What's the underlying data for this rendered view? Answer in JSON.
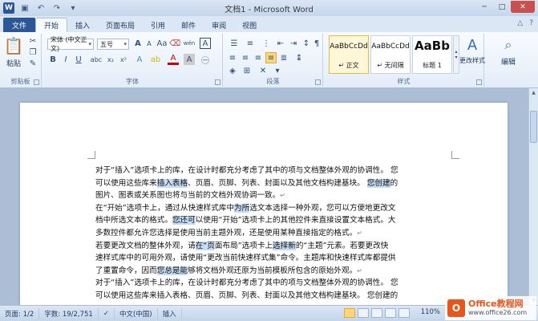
{
  "titlebar": {
    "app_icon": "W",
    "title": "文档1 - Microsoft Word",
    "qat_icons": [
      "save-icon",
      "undo-icon",
      "redo-icon",
      "customize-icon"
    ],
    "minimize": "─",
    "maximize": "□",
    "close": "✕"
  },
  "tabs": {
    "file": "文件",
    "items": [
      "开始",
      "插入",
      "页面布局",
      "引用",
      "邮件",
      "审阅",
      "视图"
    ],
    "active": "开始"
  },
  "ribbon": {
    "clipboard": {
      "label": "剪贴板",
      "paste": "粘贴"
    },
    "font": {
      "label": "字体",
      "font_name": "宋体 (中文正文)",
      "font_size": "五号",
      "wen": "wén",
      "a_letter": "A"
    },
    "paragraph": {
      "label": "段落"
    },
    "styles": {
      "label": "样式",
      "items": [
        {
          "sample": "AaBbCcDd",
          "name": "↵ 正文",
          "selected": true
        },
        {
          "sample": "AaBbCcDd",
          "name": "↵ 无间隔",
          "selected": false
        },
        {
          "sample": "AaBb",
          "name": "标题 1",
          "selected": false
        }
      ],
      "change_styles": "更改样式"
    },
    "editing": {
      "label": "编辑"
    }
  },
  "document": {
    "lines": [
      [
        {
          "t": "对于“插入”选项卡上的库，在设计时都充分考虑了其中的项与文档整体外观的协调性。 您"
        }
      ],
      [
        {
          "t": "可以使用这些库来"
        },
        {
          "t": "插入表格",
          "h": true
        },
        {
          "t": "、页眉、页脚、列表、封面以及其他文档构建基块。 "
        },
        {
          "t": "您创建",
          "h": true
        },
        {
          "t": "的"
        }
      ],
      [
        {
          "t": "图片、图表或关系图也将与当前的文档外观协调一致。"
        },
        {
          "t": "↵",
          "p": true
        }
      ],
      [
        {
          "t": "在“开始”选项卡上，通过从快速样式库中"
        },
        {
          "t": "为所",
          "h": true
        },
        {
          "t": "选文本选择一种外观，您可以方便地更改文"
        }
      ],
      [
        {
          "t": "档中所选文本的格式。"
        },
        {
          "t": "您还可",
          "h": true
        },
        {
          "t": "以使用“开始”选项卡上的其他控件来直接设置文本格式。大"
        }
      ],
      [
        {
          "t": "多数控件都允许您选择是使用当前主题外观，还是使用某种直接指定的格式。"
        },
        {
          "t": "↵",
          "p": true
        }
      ],
      [
        {
          "t": "若要更改文档的整体外观，请"
        },
        {
          "t": "在“页",
          "h": true
        },
        {
          "t": "面布局”选项卡上"
        },
        {
          "t": "选择新",
          "h": true
        },
        {
          "t": "的“主题”元素。若要更改快"
        }
      ],
      [
        {
          "t": "速样式库中的可用外观，请使用“更改当前快速样式集”命令。主题库和快速样式库都提供"
        }
      ],
      [
        {
          "t": "了重置命令，因而"
        },
        {
          "t": "您总是能",
          "h": true
        },
        {
          "t": "够将文档外观还原为当前模板所包含的原始外观。"
        },
        {
          "t": "↵",
          "p": true
        }
      ],
      [
        {
          "t": "对于“插入”选项卡上的库，在设计时都充分考虑了其中的项与文档整体外观的协调性。 您"
        }
      ],
      [
        {
          "t": "可以使用这些库来插入表格、页眉、页脚、列表、封面以及其他文档构建基块。 您创建的"
        }
      ]
    ]
  },
  "statusbar": {
    "page": "页面: 1/2",
    "words": "字数: 19/2,751",
    "language": "中文(中国)",
    "mode": "插入",
    "zoom": "110%"
  },
  "logo": {
    "mark": "O",
    "line1": "Office教程网",
    "line2": "www.office26.com"
  },
  "colors": {
    "file_tab": "#2b5797",
    "highlight": "#c6dcf5",
    "logo": "#e8561e"
  }
}
